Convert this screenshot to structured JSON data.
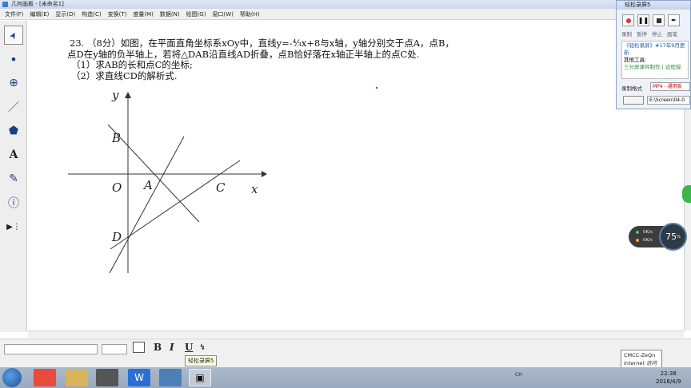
{
  "window": {
    "title": "几何画板 - [未命名1]"
  },
  "menu": [
    "文件(F)",
    "编辑(E)",
    "显示(D)",
    "构造(C)",
    "变换(T)",
    "度量(M)",
    "数据(N)",
    "绘图(G)",
    "窗口(W)",
    "帮助(H)"
  ],
  "tools": [
    {
      "name": "select-arrow-tool",
      "glyph": "➤"
    },
    {
      "name": "point-tool",
      "glyph": "•"
    },
    {
      "name": "compass-tool",
      "glyph": "⊕"
    },
    {
      "name": "straightedge-tool",
      "glyph": "／"
    },
    {
      "name": "polygon-tool",
      "glyph": "⬟"
    },
    {
      "name": "text-tool",
      "glyph": "A"
    },
    {
      "name": "marker-tool",
      "glyph": "✎"
    },
    {
      "name": "information-tool",
      "glyph": "ⓘ"
    },
    {
      "name": "custom-tool",
      "glyph": "▶⋮"
    }
  ],
  "problem": {
    "line1": "23. （8分）如图，在平面直角坐标系xOy中，直线y=-⁴⁄₃x+8与x轴，y轴分别交于点A，点B，",
    "line2": "点D在y轴的负半轴上，若将△DAB沿直线AD折叠，点B恰好落在x轴正半轴上的点C处.",
    "line3": "（1）求AB的长和点C的坐标;",
    "line4": "（2）求直线CD的解析式."
  },
  "figure": {
    "axis_x": "x",
    "axis_y": "y",
    "origin": "O",
    "points": {
      "A": "A",
      "B": "B",
      "C": "C",
      "D": "D"
    }
  },
  "format_bar": {
    "bold": "B",
    "italic": "I",
    "underline": "U",
    "tooltip": "轻松录屏5"
  },
  "recorder": {
    "title": "轻松录屏5",
    "labels": [
      "录制",
      "暂停",
      "停止",
      "画笔"
    ],
    "info_lines": [
      "《轻松录屏》#17年9月更新",
      "其他工具:",
      "三分屏课件制作 | 远程授"
    ],
    "format_label": "录制格式",
    "format_value": "MP4 - 通用版",
    "path_value": "E:\\Screen\\04-0"
  },
  "network": {
    "up": "0K/s",
    "down": "0K/s",
    "percent": "75",
    "percent_unit": "%"
  },
  "network_tip": {
    "line1": "CMCC-ZeQn",
    "line2": "Internet 访问"
  },
  "taskbar": {
    "tray_text": "CH",
    "time": "22:38",
    "date": "2018/4/9"
  }
}
